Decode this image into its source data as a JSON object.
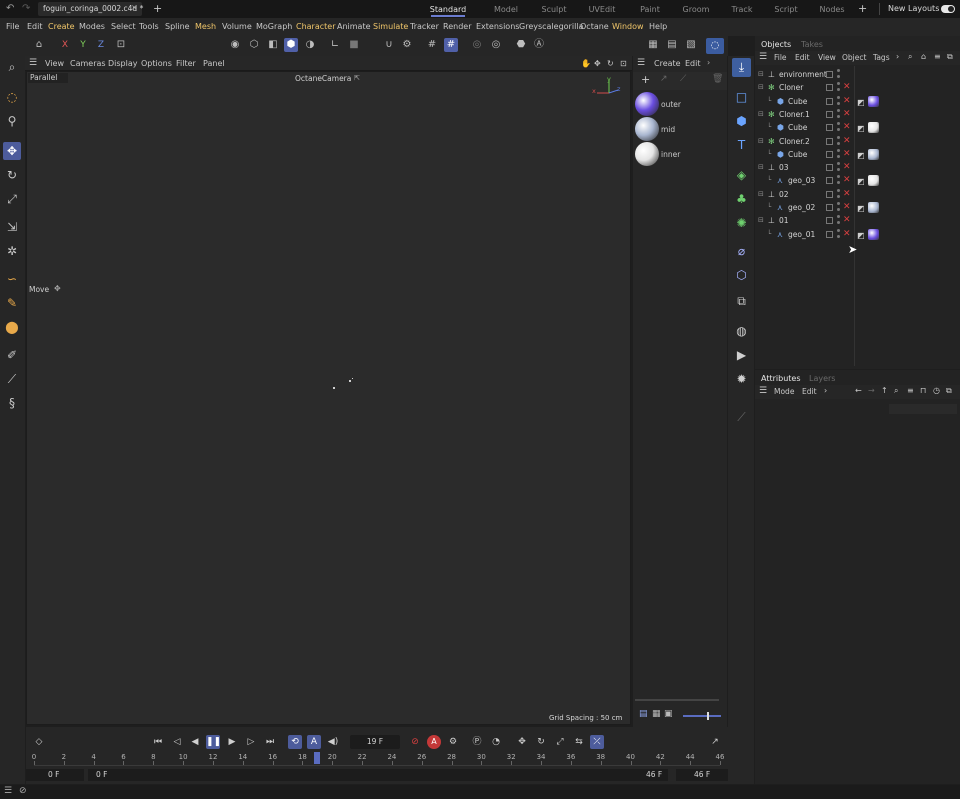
{
  "titlebar": {
    "filename": "foguin_coringa_0002.c4d *",
    "new_tab_symbol": "+",
    "workspace_tabs": [
      "Standard",
      "Model",
      "Sculpt",
      "UVEdit",
      "Paint",
      "Groom",
      "Track",
      "Script",
      "Nodes"
    ],
    "add_layout_symbol": "+",
    "new_layouts_label": "New Layouts"
  },
  "menubar": {
    "items": [
      "File",
      "Edit",
      "Create",
      "Modes",
      "Select",
      "Tools",
      "Spline",
      "Mesh",
      "Volume",
      "MoGraph",
      "Character",
      "Animate",
      "Simulate",
      "Tracker",
      "Render",
      "Extensions",
      "Greyscalegorilla",
      "Octane",
      "Window",
      "Help"
    ]
  },
  "toolbar": {
    "axis_x": "X",
    "axis_y": "Y",
    "axis_z": "Z"
  },
  "viewport": {
    "menu": [
      "View",
      "Cameras",
      "Display",
      "Options",
      "Filter",
      "Panel"
    ],
    "projection_label": "Parallel",
    "camera_label": "OctaneCamera",
    "tool_label": "Move",
    "grid_spacing": "Grid Spacing : 50 cm",
    "axis_x": "x",
    "axis_y": "y",
    "axis_z": "z"
  },
  "materials": {
    "menu": [
      "Create",
      "Edit"
    ],
    "items": [
      {
        "name": "outer",
        "color": "#6a4ee0"
      },
      {
        "name": "mid",
        "color": "#a9b6d0"
      },
      {
        "name": "inner",
        "color": "#e4e4e4"
      }
    ]
  },
  "objects": {
    "tabs": [
      "Objects",
      "Takes"
    ],
    "menu": [
      "File",
      "Edit",
      "View",
      "Object",
      "Tags"
    ],
    "rows": [
      {
        "name": "environment",
        "indent": 0,
        "tags": []
      },
      {
        "name": "Cloner",
        "indent": 0,
        "tags": []
      },
      {
        "name": "Cube",
        "indent": 1,
        "tags": [
          "#6a4ee0"
        ]
      },
      {
        "name": "Cloner.1",
        "indent": 0,
        "tags": []
      },
      {
        "name": "Cube",
        "indent": 1,
        "tags": [
          "#e4e4e4"
        ]
      },
      {
        "name": "Cloner.2",
        "indent": 0,
        "tags": []
      },
      {
        "name": "Cube",
        "indent": 1,
        "tags": [
          "#a9b6d0"
        ]
      },
      {
        "name": "03",
        "indent": 0,
        "tags": []
      },
      {
        "name": "geo_03",
        "indent": 1,
        "tags": [
          "#e4e4e4"
        ]
      },
      {
        "name": "02",
        "indent": 0,
        "tags": []
      },
      {
        "name": "geo_02",
        "indent": 1,
        "tags": [
          "#a9b6d0"
        ]
      },
      {
        "name": "01",
        "indent": 0,
        "tags": []
      },
      {
        "name": "geo_01",
        "indent": 1,
        "tags": [
          "#6a4ee0"
        ]
      }
    ]
  },
  "attributes": {
    "tabs": [
      "Attributes",
      "Layers"
    ],
    "menu": [
      "Mode",
      "Edit"
    ]
  },
  "timeline": {
    "current_frame": "19 F",
    "ticks": [
      "0",
      "2",
      "4",
      "6",
      "8",
      "10",
      "12",
      "14",
      "16",
      "18",
      "20",
      "22",
      "24",
      "26",
      "28",
      "30",
      "32",
      "34",
      "36",
      "38",
      "40",
      "42",
      "44",
      "46"
    ],
    "start_frame": "0 F",
    "range_start": "0 F",
    "range_end": "46 F",
    "end_frame": "46 F",
    "playhead_value": 19,
    "max_frame": 46
  },
  "colors": {
    "accent": "#5060a8",
    "highlight_menu": "#f0c66a",
    "delete_red": "#d84040"
  }
}
